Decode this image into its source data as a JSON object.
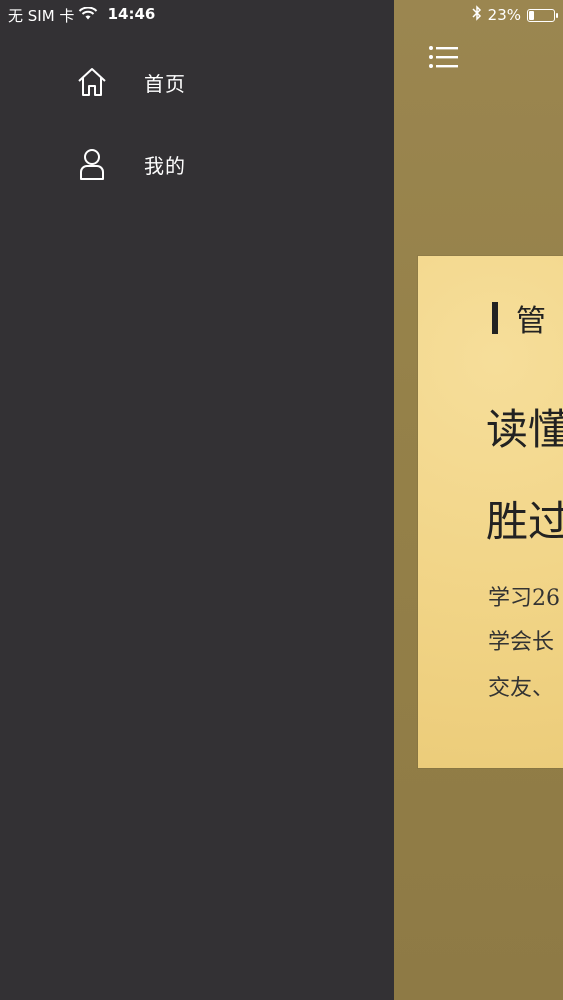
{
  "status_bar": {
    "carrier": "无 SIM 卡",
    "time": "14:46",
    "battery": "23%",
    "battery_level": 0.23
  },
  "drawer": {
    "items": [
      {
        "label": "首页",
        "icon": "home-icon"
      },
      {
        "label": "我的",
        "icon": "user-icon"
      }
    ]
  },
  "main": {
    "menu_icon": "menu-list-icon",
    "card": {
      "tag": "管",
      "title_line1": "读懂",
      "title_line2": "胜过",
      "text_line1": "学习26",
      "text_line2": "学会长",
      "text_line3": "交友、"
    }
  }
}
